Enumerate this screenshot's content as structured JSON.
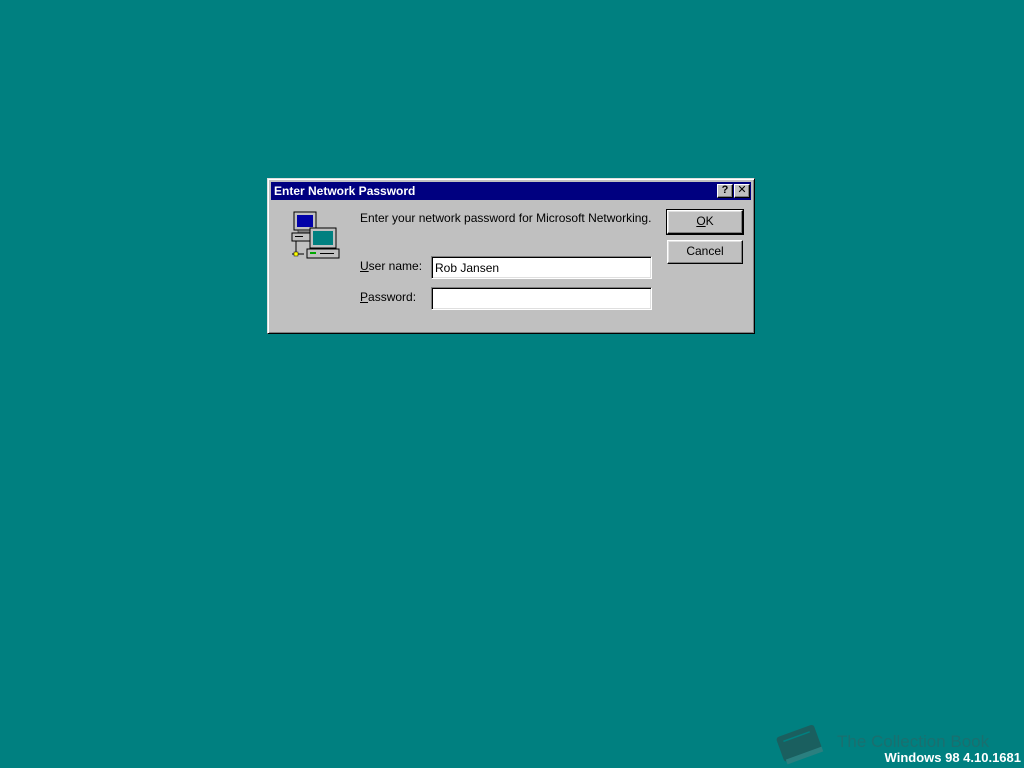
{
  "desktop": {
    "background_color": "#008080",
    "watermark_text": "The Collection Book",
    "version_text": "Windows 98 4.10.1681"
  },
  "dialog": {
    "title": "Enter Network Password",
    "help_button": "?",
    "close_button": "✕",
    "icon": "network-computers-icon",
    "message": "Enter your network password for Microsoft Networking.",
    "username_label_accel": "U",
    "username_label_rest": "ser name:",
    "username_value": "Rob Jansen",
    "password_label_accel": "P",
    "password_label_rest": "assword:",
    "password_value": "",
    "ok_button_accel": "O",
    "ok_button_rest": "K",
    "cancel_button": "Cancel"
  },
  "colors": {
    "titlebar": "#000080",
    "window": "#c0c0c0"
  }
}
